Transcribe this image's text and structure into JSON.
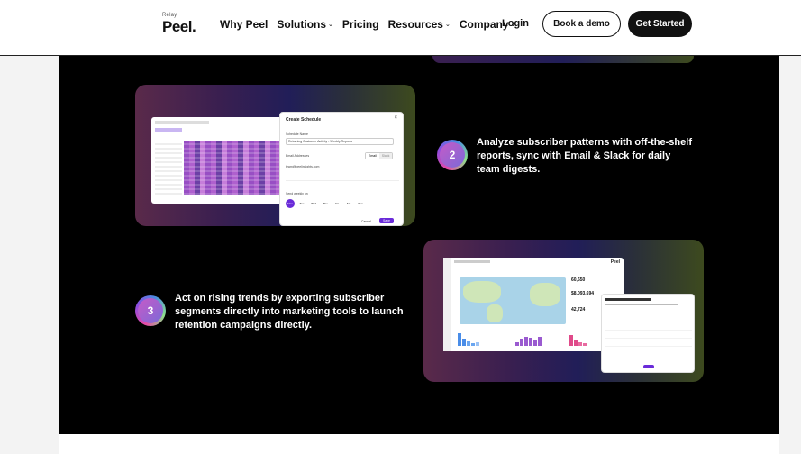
{
  "header": {
    "logo_small": "Relay",
    "logo_big": "Peel.",
    "nav": [
      {
        "label": "Why Peel",
        "dropdown": false
      },
      {
        "label": "Solutions",
        "dropdown": true
      },
      {
        "label": "Pricing",
        "dropdown": false
      },
      {
        "label": "Resources",
        "dropdown": true
      },
      {
        "label": "Company",
        "dropdown": true
      }
    ],
    "login": "Login",
    "book_demo": "Book a demo",
    "get_started": "Get Started"
  },
  "steps": [
    {
      "number": "2",
      "text": "Analyze subscriber patterns with off-the-shelf reports, sync with Email & Slack for daily team digests."
    },
    {
      "number": "3",
      "text": "Act on rising trends by exporting subscriber segments directly into marketing tools to launch retention campaigns directly."
    }
  ],
  "card1": {
    "modal_title": "Create Schedule",
    "schedule_name_label": "Schedule Name",
    "schedule_name_value": "Returning Customer Activity - Weekly Reports",
    "email_label": "Email Addresses",
    "email_value": "team@peelinsights.com",
    "toggle_on": "Email",
    "toggle_off": "Slack",
    "send_label": "Send weekly on",
    "days": [
      "Mon",
      "Tue",
      "Wed",
      "Thu",
      "Fri",
      "Sat",
      "Sun"
    ],
    "cancel": "Cancel",
    "save": "Save"
  },
  "card2": {
    "logo": "Peel",
    "stats": [
      "60,650",
      "$8,093,694",
      "42,724"
    ]
  },
  "colors": {
    "accent_purple": "#6a2bd9",
    "dark_bg": "#000000"
  }
}
